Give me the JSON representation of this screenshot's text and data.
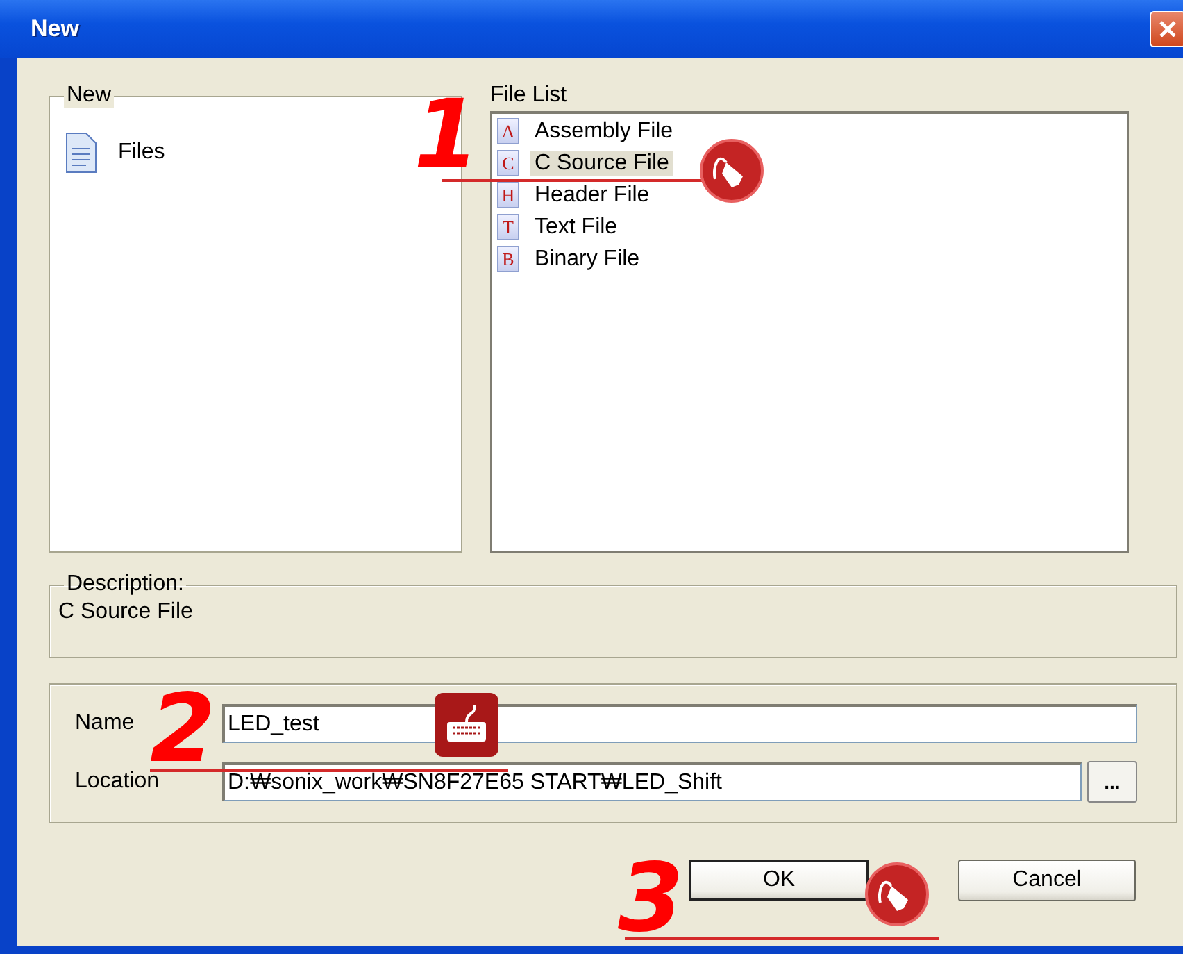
{
  "window": {
    "title": "New"
  },
  "new_group": {
    "label": "New",
    "items": [
      {
        "label": "Files",
        "selected": false
      }
    ]
  },
  "file_list": {
    "label": "File List",
    "items": [
      {
        "badge": "A",
        "label": "Assembly File",
        "selected": false
      },
      {
        "badge": "C",
        "label": "C Source File",
        "selected": true
      },
      {
        "badge": "H",
        "label": "Header File",
        "selected": false
      },
      {
        "badge": "T",
        "label": "Text File",
        "selected": false
      },
      {
        "badge": "B",
        "label": "Binary File",
        "selected": false
      }
    ]
  },
  "description": {
    "label": "Description:",
    "text": "C Source File"
  },
  "fields": [
    {
      "label": "Name",
      "value": "LED_test"
    },
    {
      "label": "Location",
      "value": "D:₩sonix_work₩SN8F27E65 START₩LED_Shift",
      "button": "..."
    }
  ],
  "buttons": [
    {
      "label": "OK",
      "default": true
    },
    {
      "label": "Cancel",
      "default": false
    }
  ],
  "annotations": [
    {
      "number": "1",
      "kind": "click"
    },
    {
      "number": "2",
      "kind": "type"
    },
    {
      "number": "3",
      "kind": "click"
    }
  ]
}
